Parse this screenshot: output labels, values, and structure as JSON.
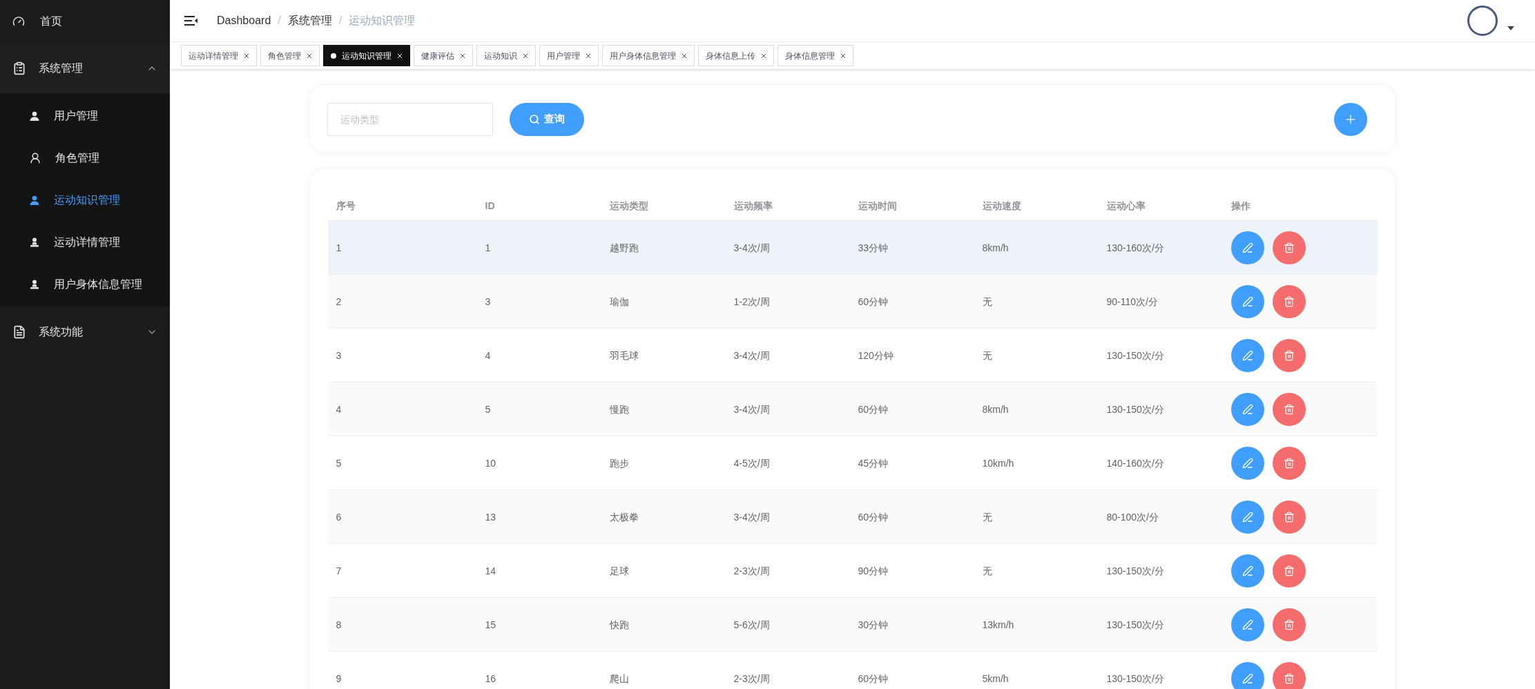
{
  "sidebar": {
    "items": [
      {
        "kind": "link",
        "label": "首页",
        "selected": false
      },
      {
        "kind": "group",
        "label": "系统管理",
        "expanded": true,
        "children": [
          {
            "label": "用户管理",
            "selected": false
          },
          {
            "label": "角色管理",
            "selected": false
          },
          {
            "label": "运动知识管理",
            "selected": true
          },
          {
            "label": "运动详情管理",
            "selected": false
          },
          {
            "label": "用户身体信息管理",
            "selected": false
          }
        ]
      },
      {
        "kind": "group",
        "label": "系统功能",
        "expanded": false
      }
    ]
  },
  "breadcrumb": [
    {
      "label": "Dashboard"
    },
    {
      "separator": "/",
      "label": "系统管理"
    },
    {
      "separator": "/",
      "label": "运动知识管理"
    }
  ],
  "tabs": [
    {
      "label": "运动详情管理",
      "selected": false
    },
    {
      "label": "角色管理",
      "selected": false
    },
    {
      "label": "运动知识管理",
      "selected": true
    },
    {
      "label": "健康评估",
      "selected": false
    },
    {
      "label": "运动知识",
      "selected": false
    },
    {
      "label": "用户管理",
      "selected": false
    },
    {
      "label": "用户身体信息管理",
      "selected": false
    },
    {
      "label": "身体信息上传",
      "selected": false
    },
    {
      "label": "身体信息管理",
      "selected": false
    }
  ],
  "search": {
    "placeholder": "运动类型",
    "button": "查询"
  },
  "table": {
    "columns": [
      "序号",
      "ID",
      "运动类型",
      "运动频率",
      "运动时间",
      "运动速度",
      "运动心率",
      "操作"
    ],
    "rows": [
      {
        "highlighted": true,
        "cells": [
          "1",
          "1",
          "越野跑",
          "3-4次/周",
          "33分钟",
          "8km/h",
          "130-160次/分"
        ]
      },
      {
        "highlighted": false,
        "cells": [
          "2",
          "3",
          "瑜伽",
          "1-2次/周",
          "60分钟",
          "无",
          "90-110次/分"
        ]
      },
      {
        "highlighted": false,
        "cells": [
          "3",
          "4",
          "羽毛球",
          "3-4次/周",
          "120分钟",
          "无",
          "130-150次/分"
        ]
      },
      {
        "highlighted": false,
        "cells": [
          "4",
          "5",
          "慢跑",
          "3-4次/周",
          "60分钟",
          "8km/h",
          "130-150次/分"
        ]
      },
      {
        "highlighted": false,
        "cells": [
          "5",
          "10",
          "跑步",
          "4-5次/周",
          "45分钟",
          "10km/h",
          "140-160次/分"
        ]
      },
      {
        "highlighted": false,
        "cells": [
          "6",
          "13",
          "太极拳",
          "3-4次/周",
          "60分钟",
          "无",
          "80-100次/分"
        ]
      },
      {
        "highlighted": false,
        "cells": [
          "7",
          "14",
          "足球",
          "2-3次/周",
          "90分钟",
          "无",
          "130-150次/分"
        ]
      },
      {
        "highlighted": false,
        "cells": [
          "8",
          "15",
          "快跑",
          "5-6次/周",
          "30分钟",
          "13km/h",
          "130-150次/分"
        ]
      },
      {
        "highlighted": false,
        "cells": [
          "9",
          "16",
          "爬山",
          "2-3次/周",
          "60分钟",
          "5km/h",
          "130-150次/分"
        ]
      }
    ]
  }
}
